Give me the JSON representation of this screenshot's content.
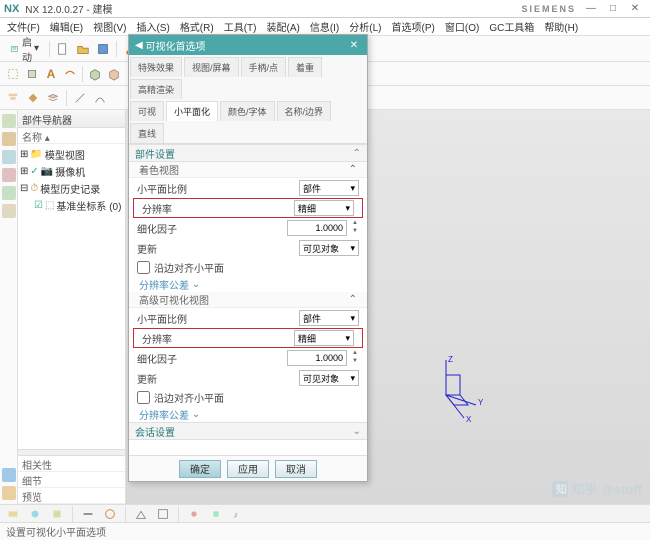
{
  "title": {
    "app": "NX",
    "version": "NX 12.0.0.27 - 建模",
    "brand": "SIEMENS"
  },
  "menu": [
    "文件(F)",
    "编辑(E)",
    "视图(V)",
    "插入(S)",
    "格式(R)",
    "工具(T)",
    "装配(A)",
    "信息(I)",
    "分析(L)",
    "首选项(P)",
    "窗口(O)",
    "GC工具箱",
    "帮助(H)"
  ],
  "toolbar1": {
    "start": "启动"
  },
  "nav": {
    "header": "部件导航器",
    "name_col": "名称",
    "tree": [
      {
        "label": "模型视图",
        "icon": "folder"
      },
      {
        "label": "摄像机",
        "icon": "camera",
        "checked": true
      },
      {
        "label": "模型历史记录",
        "icon": "history"
      },
      {
        "label": "基准坐标系 (0)",
        "icon": "csys",
        "checked": true,
        "indent": 1
      }
    ],
    "footers": [
      "相关性",
      "细节",
      "预览"
    ]
  },
  "dialog": {
    "title": "可视化首选项",
    "tabs_row1": [
      "特殊效果",
      "视图/屏幕",
      "手柄/点",
      "着重",
      "高精渲染"
    ],
    "tabs_row2": [
      "可视",
      "小平面化",
      "颜色/字体",
      "名称/边界",
      "直线"
    ],
    "active_tab": "小平面化",
    "sections": {
      "part_settings": "部件设置",
      "shaded_view": "着色视图",
      "adv_viz_view": "高级可视化视图",
      "session": "会话设置"
    },
    "fields": {
      "facet_ratio": "小平面比例",
      "resolution": "分辨率",
      "refine_factor": "细化因子",
      "update": "更新",
      "edge_facet": "沿边对齐小平面",
      "facet_tol": "分辨率公差"
    },
    "values": {
      "part": "部件",
      "fine": "精细",
      "factor": "1.0000",
      "visible": "可见对象"
    },
    "buttons": {
      "ok": "确定",
      "apply": "应用",
      "cancel": "取消"
    }
  },
  "status": "设置可视化小平面选项",
  "watermark": "知乎 @stoff"
}
